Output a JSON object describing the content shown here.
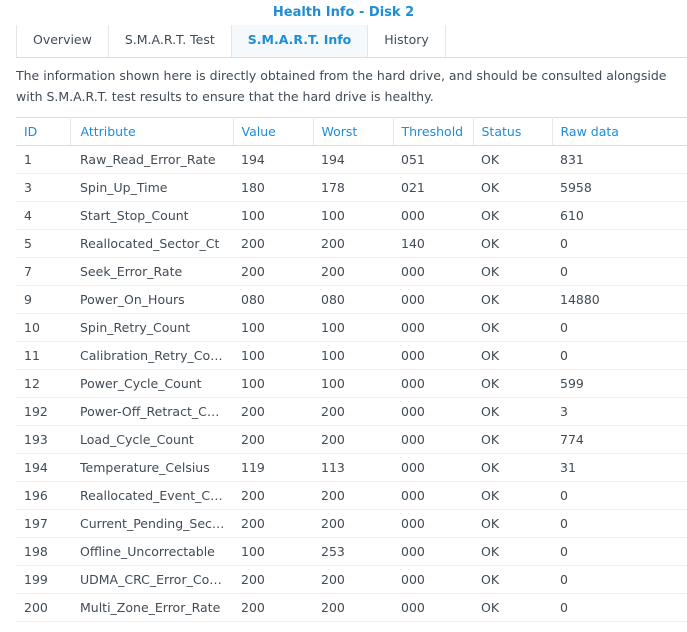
{
  "window": {
    "title": "Health Info - Disk 2"
  },
  "tabs": [
    {
      "label": "Overview",
      "active": false
    },
    {
      "label": "S.M.A.R.T. Test",
      "active": false
    },
    {
      "label": "S.M.A.R.T. Info",
      "active": true
    },
    {
      "label": "History",
      "active": false
    }
  ],
  "description": "The information shown here is directly obtained from the hard drive, and should be consulted alongside with S.M.A.R.T. test results to ensure that the hard drive is healthy.",
  "table": {
    "columns": [
      "ID",
      "Attribute",
      "Value",
      "Worst",
      "Threshold",
      "Status",
      "Raw data"
    ],
    "rows": [
      [
        "1",
        "Raw_Read_Error_Rate",
        "194",
        "194",
        "051",
        "OK",
        "831"
      ],
      [
        "3",
        "Spin_Up_Time",
        "180",
        "178",
        "021",
        "OK",
        "5958"
      ],
      [
        "4",
        "Start_Stop_Count",
        "100",
        "100",
        "000",
        "OK",
        "610"
      ],
      [
        "5",
        "Reallocated_Sector_Ct",
        "200",
        "200",
        "140",
        "OK",
        "0"
      ],
      [
        "7",
        "Seek_Error_Rate",
        "200",
        "200",
        "000",
        "OK",
        "0"
      ],
      [
        "9",
        "Power_On_Hours",
        "080",
        "080",
        "000",
        "OK",
        "14880"
      ],
      [
        "10",
        "Spin_Retry_Count",
        "100",
        "100",
        "000",
        "OK",
        "0"
      ],
      [
        "11",
        "Calibration_Retry_Count",
        "100",
        "100",
        "000",
        "OK",
        "0"
      ],
      [
        "12",
        "Power_Cycle_Count",
        "100",
        "100",
        "000",
        "OK",
        "599"
      ],
      [
        "192",
        "Power-Off_Retract_Cou...",
        "200",
        "200",
        "000",
        "OK",
        "3"
      ],
      [
        "193",
        "Load_Cycle_Count",
        "200",
        "200",
        "000",
        "OK",
        "774"
      ],
      [
        "194",
        "Temperature_Celsius",
        "119",
        "113",
        "000",
        "OK",
        "31"
      ],
      [
        "196",
        "Reallocated_Event_Co...",
        "200",
        "200",
        "000",
        "OK",
        "0"
      ],
      [
        "197",
        "Current_Pending_Sector",
        "200",
        "200",
        "000",
        "OK",
        "0"
      ],
      [
        "198",
        "Offline_Uncorrectable",
        "100",
        "253",
        "000",
        "OK",
        "0"
      ],
      [
        "199",
        "UDMA_CRC_Error_Count",
        "200",
        "200",
        "000",
        "OK",
        "0"
      ],
      [
        "200",
        "Multi_Zone_Error_Rate",
        "200",
        "200",
        "000",
        "OK",
        "0"
      ]
    ]
  },
  "colors": {
    "accent": "#1d8dd6",
    "text": "#414b55",
    "border": "#d9dde2"
  }
}
